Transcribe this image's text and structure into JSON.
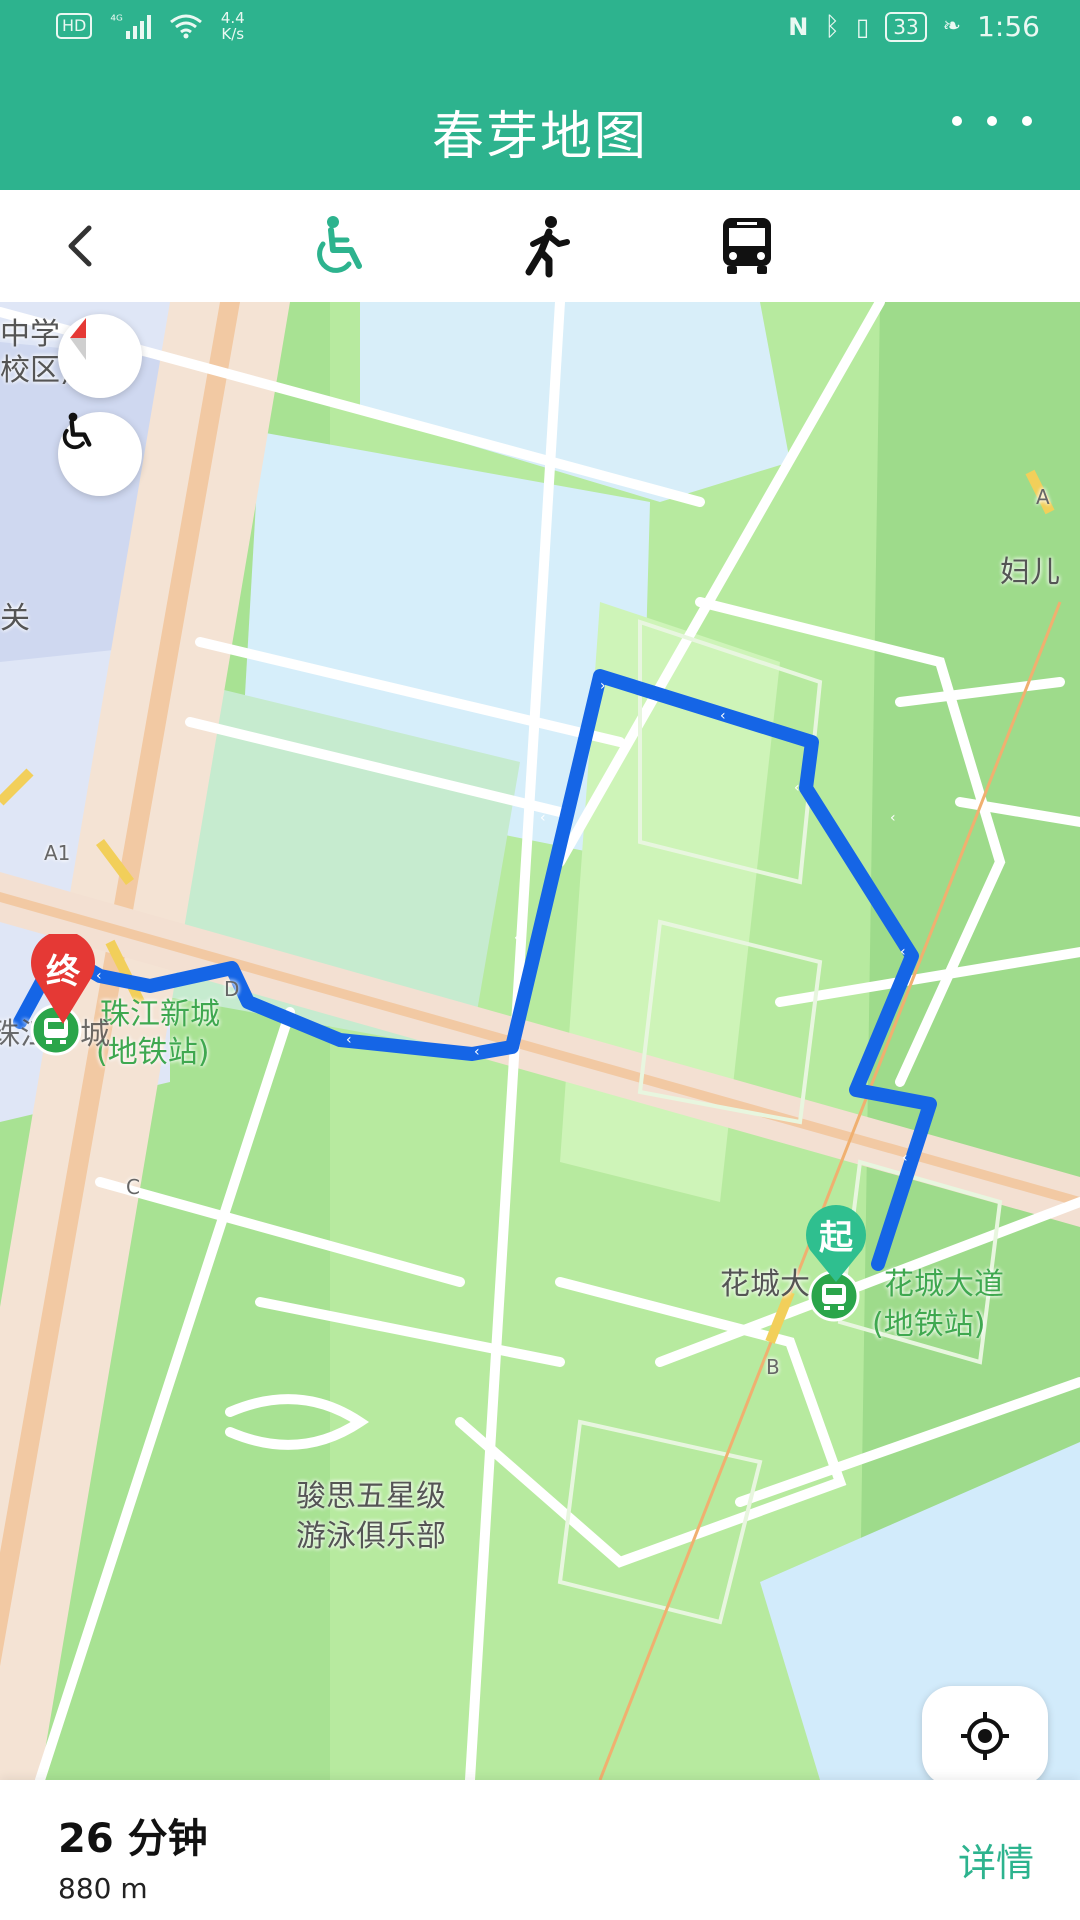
{
  "status_bar": {
    "left_badge": "HD",
    "net_type": "⁴ᴳ",
    "speed_value": "4.4",
    "speed_unit": "K/s",
    "battery": "33",
    "time": "1:56"
  },
  "app_bar": {
    "title": "春芽地图"
  },
  "modes": [
    {
      "name": "wheelchair",
      "icon": "wheelchair-icon",
      "selected": true
    },
    {
      "name": "walk",
      "icon": "walking-icon",
      "selected": false
    },
    {
      "name": "bus",
      "icon": "bus-icon",
      "selected": false
    }
  ],
  "map": {
    "labels": {
      "school_top": "中学",
      "school_bottom": "校区)",
      "left_guan": "关",
      "zhujiang_line1": "珠江新城",
      "zhujiang_line2": "(地铁站)",
      "zhujiang_partial": "珠江新城",
      "huacheng_left": "花城大",
      "huacheng_line1": "花城大道",
      "huacheng_line2": "(地铁站)",
      "fuer": "妇儿",
      "pool_line1": "骏思五星级",
      "pool_line2": "游泳俱乐部",
      "exit_a1": "A1",
      "exit_a": "A",
      "exit_b": "B",
      "exit_c": "C",
      "exit_d": "D"
    },
    "end_marker": "终",
    "start_marker": "起"
  },
  "route": {
    "duration": "26 分钟",
    "distance": "880 m",
    "details": "详情"
  },
  "colors": {
    "primary": "#2db38e",
    "route": "#1a73e8",
    "end_marker": "#e53935",
    "start_marker": "#2fbf8f"
  }
}
